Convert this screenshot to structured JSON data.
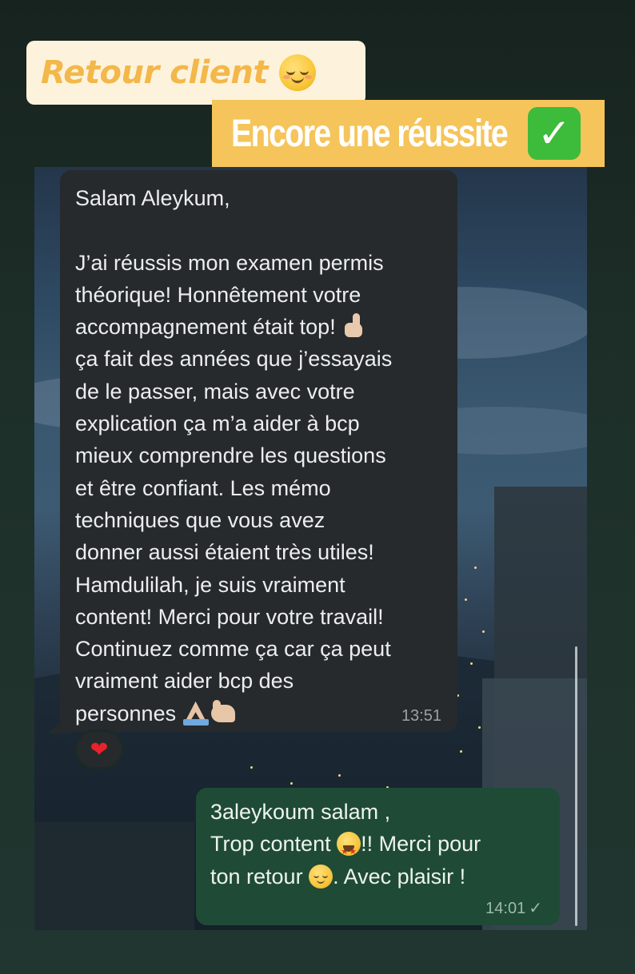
{
  "story": {
    "tag_top": "Retour client",
    "tag_top_emoji": "relieved-face-icon",
    "tag_main": "Encore une réussite",
    "tag_main_emoji": "✓"
  },
  "incoming_message": {
    "lines": [
      "Salam Aleykum,",
      "",
      "J’ai réussis mon examen permis",
      "théorique! Honnêtement votre",
      "accompagnement était top!",
      "ça fait des années que j’essayais",
      "de le passer, mais avec votre",
      "explication ça m’a aider à bcp",
      "mieux comprendre les questions",
      "et être confiant. Les mémo",
      "techniques que vous avez",
      "donner aussi étaient très utiles!",
      "Hamdulilah, je suis vraiment",
      "content! Merci pour votre travail!",
      "Continuez comme ça car ça peut",
      "vraiment aider bcp des",
      "personnes"
    ],
    "time": "13:51",
    "reaction": "❤"
  },
  "outgoing_message": {
    "line1": "3aleykoum salam ,",
    "line2_a": "Trop content",
    "line2_b": "!!  Merci pour",
    "line3_a": "ton retour",
    "line3_b": ". Avec plaisir !",
    "time": "14:01",
    "status": "✓"
  },
  "colors": {
    "tag_top_bg": "#fdf3dc",
    "tag_top_text": "#f3b74a",
    "tag_main_bg": "#f5c45a",
    "incoming_bubble": "#262a2c",
    "outgoing_bubble": "#1f4b36",
    "check_green": "#3dbb3a",
    "heart_red": "#e8222b"
  }
}
